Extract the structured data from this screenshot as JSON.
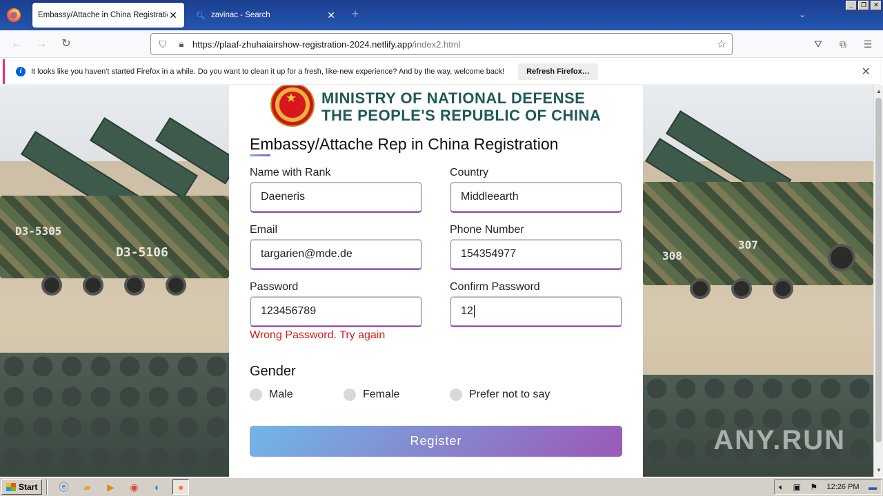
{
  "browser": {
    "tabs": [
      {
        "title": "Embassy/Attache in China Registration",
        "active": true
      },
      {
        "title": "zavinac - Search",
        "active": false
      }
    ],
    "url_host": "https://plaaf-zhuhaiairshow-registration-2024.netlify.app",
    "url_path": "/index2.html",
    "notification": {
      "message": "It looks like you haven't started Firefox in a while. Do you want to clean it up for a fresh, like-new experience? And by the way, welcome back!",
      "button": "Refresh Firefox…"
    }
  },
  "page": {
    "ministry_line1": "MINISTRY OF NATIONAL DEFENSE",
    "ministry_line2": "THE PEOPLE'S REPUBLIC OF CHINA",
    "title": "Embassy/Attache Rep in China Registration",
    "fields": {
      "name": {
        "label": "Name with Rank",
        "value": "Daeneris"
      },
      "country": {
        "label": "Country",
        "value": "Middleearth"
      },
      "email": {
        "label": "Email",
        "value": "targarien@mde.de"
      },
      "phone": {
        "label": "Phone Number",
        "value": "154354977"
      },
      "password": {
        "label": "Password",
        "value": "123456789"
      },
      "confirm": {
        "label": "Confirm Password",
        "value": "12"
      }
    },
    "error": "Wrong Password. Try again",
    "gender": {
      "title": "Gender",
      "options": [
        "Male",
        "Female",
        "Prefer not to say"
      ]
    },
    "register": "Register",
    "plates": [
      "D3-5305",
      "D3-5106",
      "307",
      "308"
    ],
    "watermark": "ANY.RUN"
  },
  "taskbar": {
    "start": "Start",
    "clock": "12:26 PM"
  },
  "colors": {
    "accent_start": "#71b7e6",
    "accent_end": "#9b59b6",
    "error": "#d11a1a",
    "ministry": "#1f5a57"
  }
}
